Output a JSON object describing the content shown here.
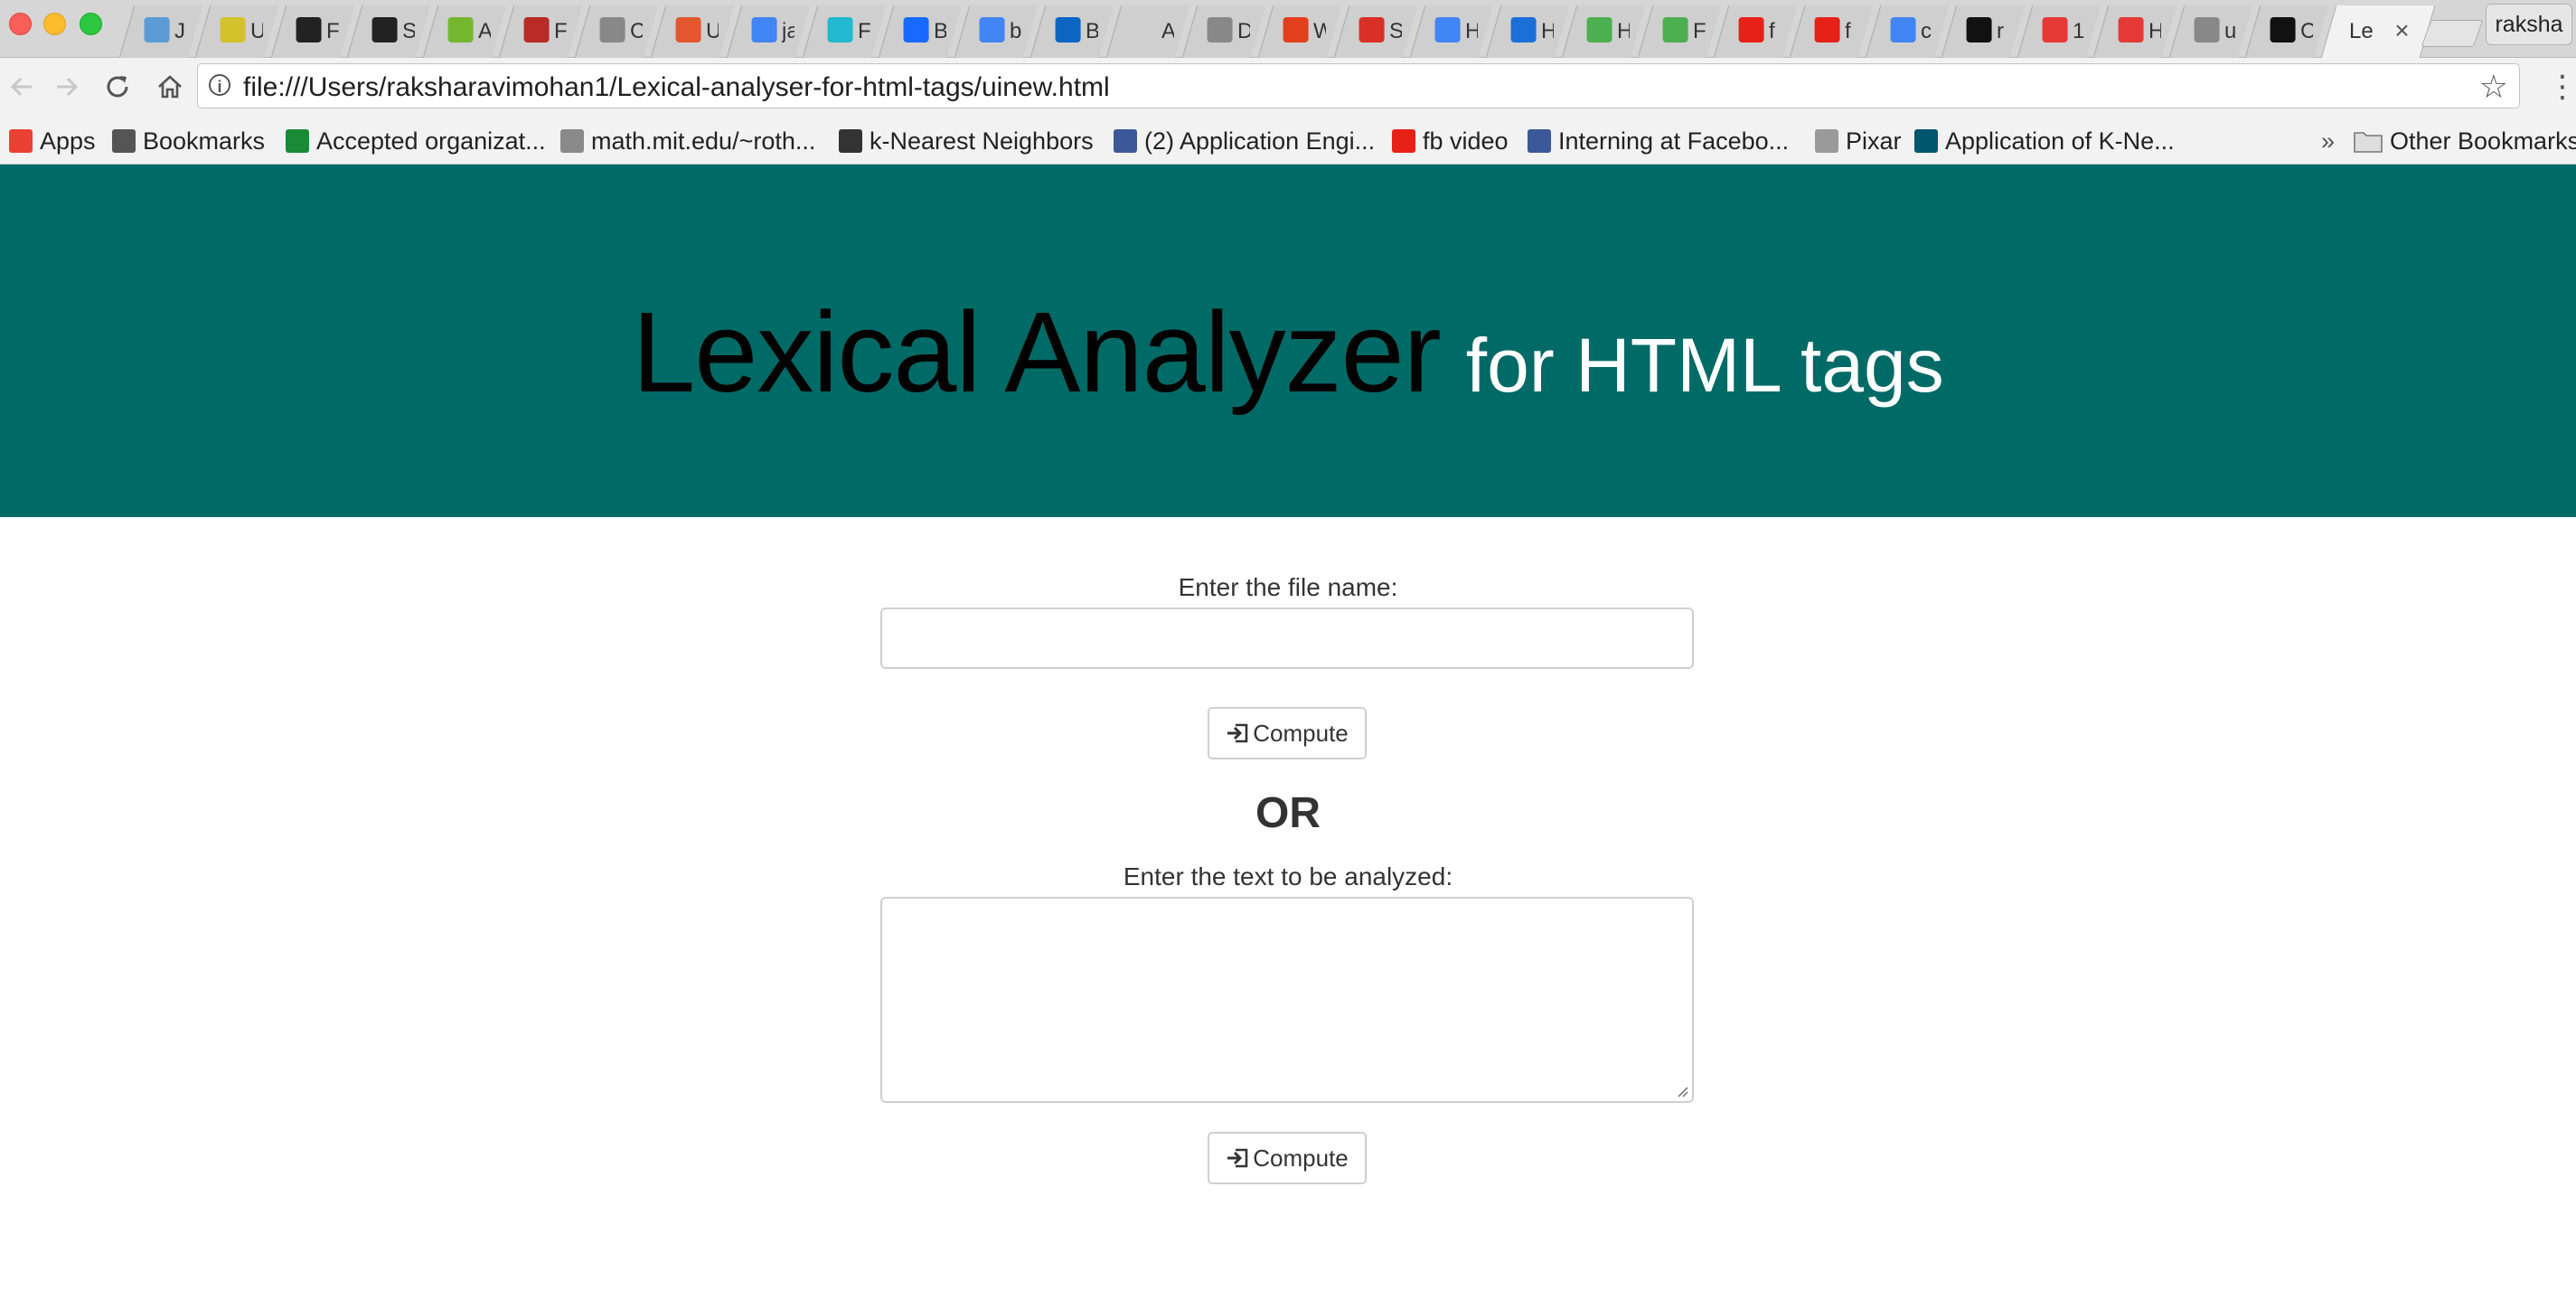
{
  "browser": {
    "tabs": [
      {
        "favicon": "pencil-icon",
        "letter": "J",
        "color": "#5b9bd5"
      },
      {
        "favicon": "lightbulb-icon",
        "letter": "U",
        "color": "#d4c22c"
      },
      {
        "favicon": "angellist-icon",
        "letter": "F",
        "color": "#222222"
      },
      {
        "favicon": "angellist-icon",
        "letter": "S",
        "color": "#222222"
      },
      {
        "favicon": "w3-icon",
        "letter": "A",
        "color": "#74b72e"
      },
      {
        "favicon": "quora-icon",
        "letter": "F",
        "color": "#b92b27"
      },
      {
        "favicon": "page-icon",
        "letter": "C",
        "color": "#888888"
      },
      {
        "favicon": "x-logo-icon",
        "letter": "U",
        "color": "#e4572e"
      },
      {
        "favicon": "google-icon",
        "letter": "ja",
        "color": "#4285f4"
      },
      {
        "favicon": "c-logo-icon",
        "letter": "F",
        "color": "#22b8cf"
      },
      {
        "favicon": "behance-icon",
        "letter": "B",
        "color": "#1769ff"
      },
      {
        "favicon": "google-icon",
        "letter": "b",
        "color": "#4285f4"
      },
      {
        "favicon": "linkedin-icon",
        "letter": "B",
        "color": "#0a66c2"
      },
      {
        "favicon": "blank-icon",
        "letter": "A",
        "color": "#cfcfcf"
      },
      {
        "favicon": "page-icon",
        "letter": "D",
        "color": "#888888"
      },
      {
        "favicon": "stop-icon",
        "letter": "W",
        "color": "#e2401c"
      },
      {
        "favicon": "gmail-icon",
        "letter": "S",
        "color": "#d93025"
      },
      {
        "favicon": "google-icon",
        "letter": "H",
        "color": "#4285f4"
      },
      {
        "favicon": "k-logo-icon",
        "letter": "H",
        "color": "#1d6fd8"
      },
      {
        "favicon": "paperclip-icon",
        "letter": "H",
        "color": "#4caf50"
      },
      {
        "favicon": "paperclip-icon",
        "letter": "F",
        "color": "#4caf50"
      },
      {
        "favicon": "youtube-icon",
        "letter": "f",
        "color": "#e62117"
      },
      {
        "favicon": "youtube-icon",
        "letter": "f",
        "color": "#e62117"
      },
      {
        "favicon": "google-icon",
        "letter": "c",
        "color": "#4285f4"
      },
      {
        "favicon": "github-icon",
        "letter": "r",
        "color": "#111111"
      },
      {
        "favicon": "swirl-icon",
        "letter": "1",
        "color": "#e53935"
      },
      {
        "favicon": "swirl-icon",
        "letter": "H",
        "color": "#e53935"
      },
      {
        "favicon": "page-icon",
        "letter": "u",
        "color": "#888888"
      },
      {
        "favicon": "github-icon",
        "letter": "C",
        "color": "#111111"
      }
    ],
    "active_tab": {
      "title": "Le"
    },
    "profile_name": "raksha",
    "url": "file:///Users/raksharavimohan1/Lexical-analyser-for-html-tags/uinew.html",
    "bookmarks": [
      {
        "label": "Apps",
        "icon": "apps-grid-icon",
        "color": "#e94235"
      },
      {
        "label": "Bookmarks",
        "icon": "star-icon",
        "color": "#555555"
      },
      {
        "label": "Accepted organizat...",
        "icon": "flag-icon",
        "color": "#1b8a36"
      },
      {
        "label": "math.mit.edu/~roth...",
        "icon": "math-icon",
        "color": "#8a8a8a"
      },
      {
        "label": "k-Nearest Neighbors",
        "icon": "graph-icon",
        "color": "#333333"
      },
      {
        "label": "(2) Application Engi...",
        "icon": "facebook-icon",
        "color": "#3b5998"
      },
      {
        "label": "fb video",
        "icon": "youtube-icon",
        "color": "#e62117"
      },
      {
        "label": "Interning at Facebo...",
        "icon": "facebook-icon",
        "color": "#3b5998"
      },
      {
        "label": "Pixar",
        "icon": "page-icon",
        "color": "#9a9a9a"
      },
      {
        "label": "Application of K-Ne...",
        "icon": "a-logo-icon",
        "color": "#00566e"
      }
    ],
    "more_bookmarks": "»",
    "other_bookmarks": "Other Bookmarks"
  },
  "page": {
    "title_main": "Lexical Analyzer",
    "title_sub": "for HTML tags",
    "header_color": "#006a66",
    "file_label": "Enter the file name:",
    "file_value": "",
    "compute_label": "Compute",
    "or_text": "OR",
    "text_label": "Enter the text to be analyzed:",
    "text_value": ""
  }
}
